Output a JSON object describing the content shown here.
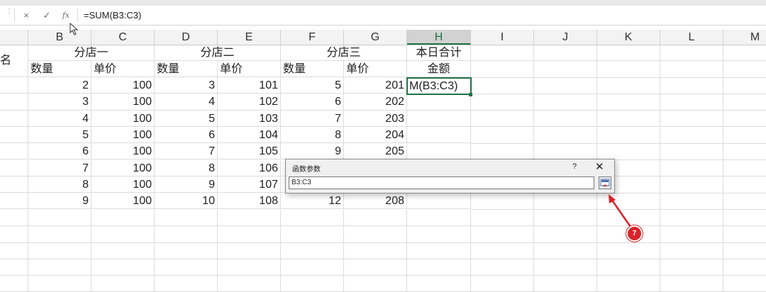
{
  "formula_bar": {
    "cancel_icon": "×",
    "confirm_icon": "✓",
    "fx_icon": "fx",
    "formula": "=SUM(B3:C3)"
  },
  "columns": [
    "B",
    "C",
    "D",
    "E",
    "F",
    "G",
    "H",
    "I",
    "J",
    "K",
    "L",
    "M"
  ],
  "selected_column": "H",
  "row_headers": {
    "row1": {
      "a": "名",
      "bc": "分店一",
      "de": "分店二",
      "fg": "分店三",
      "h": "本日合计"
    },
    "row2": {
      "b": "数量",
      "c": "单价",
      "d": "数量",
      "e": "单价",
      "f": "数量",
      "g": "单价",
      "h": "金额"
    }
  },
  "rows": [
    {
      "b": "2",
      "c": "100",
      "d": "3",
      "e": "101",
      "f": "5",
      "g": "201",
      "h": "Μ(B3:C3)"
    },
    {
      "b": "3",
      "c": "100",
      "d": "4",
      "e": "102",
      "f": "6",
      "g": "202",
      "h": ""
    },
    {
      "b": "4",
      "c": "100",
      "d": "5",
      "e": "103",
      "f": "7",
      "g": "203",
      "h": ""
    },
    {
      "b": "5",
      "c": "100",
      "d": "6",
      "e": "104",
      "f": "8",
      "g": "204",
      "h": ""
    },
    {
      "b": "6",
      "c": "100",
      "d": "7",
      "e": "105",
      "f": "9",
      "g": "205",
      "h": ""
    },
    {
      "b": "7",
      "c": "100",
      "d": "8",
      "e": "106",
      "f": "",
      "g": "",
      "h": ""
    },
    {
      "b": "8",
      "c": "100",
      "d": "9",
      "e": "107",
      "f": "",
      "g": "",
      "h": ""
    },
    {
      "b": "9",
      "c": "100",
      "d": "10",
      "e": "108",
      "f": "12",
      "g": "208",
      "h": ""
    }
  ],
  "dialog": {
    "title": "函数参数",
    "help_label": "?",
    "close_label": "✕",
    "input_value": "B3:C3"
  },
  "annotation": {
    "badge": "7",
    "color": "#d8242a"
  },
  "accent_color": "#217346"
}
